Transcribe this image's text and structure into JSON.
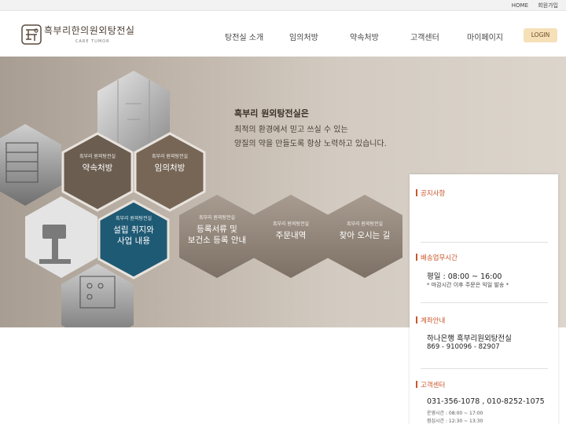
{
  "topbar": {
    "home": "HOME",
    "join": "회원가입"
  },
  "logo": {
    "name": "흑부리한의원외탕전실",
    "sub": "CARE TUMOR"
  },
  "nav": [
    "탕전실 소개",
    "임의처방",
    "약속처방",
    "고객센터",
    "마이페이지"
  ],
  "login": "LOGIN",
  "hero": {
    "line1": "흑부리 원외탕전실은",
    "line2": "최적의 환경에서 믿고 쓰실 수 있는",
    "line3": "양질의 약을 만들도록 항상 노력하고 있습니다."
  },
  "hex": [
    {
      "small": "흑부리 원외탕전실",
      "big": "약속처방"
    },
    {
      "small": "흑부리 원외탕전실",
      "big": "임의처방"
    },
    {
      "small": "흑부리 원외탕전실",
      "big": "설립 취지와",
      "big2": "사업 내용"
    },
    {
      "small": "흑부리 원외탕전실",
      "big": "등록서류 및",
      "big2": "보건소 등록 안내"
    },
    {
      "small": "흑부리 원외탕전실",
      "big": "주문내역"
    },
    {
      "small": "흑부리 원외탕전실",
      "big": "찾아 오시는 길"
    }
  ],
  "sidebar": {
    "notice": {
      "title": "공지사항"
    },
    "delivery": {
      "title": "배송업무시간",
      "time": "평일 : 08:00 ~ 16:00",
      "note": "* 마감시간 이후 주문은 익일 발송 *"
    },
    "account": {
      "title": "계좌안내",
      "bank": "하나은행 흑부리원외탕전실",
      "number": "869 - 910096 - 82907"
    },
    "support": {
      "title": "고객센터",
      "phone": "031-356-1078 , 010-8252-1075",
      "hours1": "운영시간 : 08:00 ~ 17:00",
      "hours2": "점심시간 : 12:30 ~ 13:30"
    }
  },
  "colors": {
    "accent": "#c9562b",
    "hex_brown": "#6b5d4f",
    "hex_teal": "#1f5a74",
    "login_bg": "#f6e0b8"
  }
}
